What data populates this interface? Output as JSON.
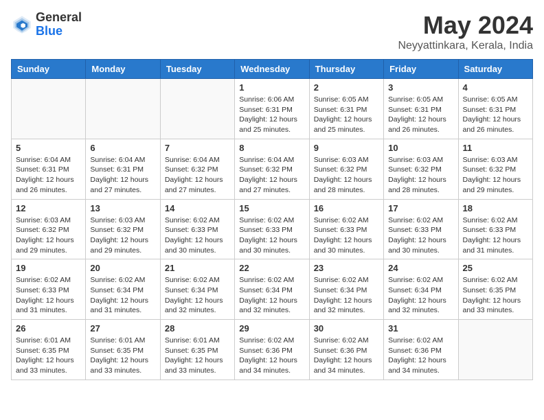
{
  "header": {
    "logo_general": "General",
    "logo_blue": "Blue",
    "title": "May 2024",
    "subtitle": "Neyyattinkara, Kerala, India"
  },
  "weekdays": [
    "Sunday",
    "Monday",
    "Tuesday",
    "Wednesday",
    "Thursday",
    "Friday",
    "Saturday"
  ],
  "weeks": [
    [
      {
        "day": "",
        "info": ""
      },
      {
        "day": "",
        "info": ""
      },
      {
        "day": "",
        "info": ""
      },
      {
        "day": "1",
        "info": "Sunrise: 6:06 AM\nSunset: 6:31 PM\nDaylight: 12 hours\nand 25 minutes."
      },
      {
        "day": "2",
        "info": "Sunrise: 6:05 AM\nSunset: 6:31 PM\nDaylight: 12 hours\nand 25 minutes."
      },
      {
        "day": "3",
        "info": "Sunrise: 6:05 AM\nSunset: 6:31 PM\nDaylight: 12 hours\nand 26 minutes."
      },
      {
        "day": "4",
        "info": "Sunrise: 6:05 AM\nSunset: 6:31 PM\nDaylight: 12 hours\nand 26 minutes."
      }
    ],
    [
      {
        "day": "5",
        "info": "Sunrise: 6:04 AM\nSunset: 6:31 PM\nDaylight: 12 hours\nand 26 minutes."
      },
      {
        "day": "6",
        "info": "Sunrise: 6:04 AM\nSunset: 6:31 PM\nDaylight: 12 hours\nand 27 minutes."
      },
      {
        "day": "7",
        "info": "Sunrise: 6:04 AM\nSunset: 6:32 PM\nDaylight: 12 hours\nand 27 minutes."
      },
      {
        "day": "8",
        "info": "Sunrise: 6:04 AM\nSunset: 6:32 PM\nDaylight: 12 hours\nand 27 minutes."
      },
      {
        "day": "9",
        "info": "Sunrise: 6:03 AM\nSunset: 6:32 PM\nDaylight: 12 hours\nand 28 minutes."
      },
      {
        "day": "10",
        "info": "Sunrise: 6:03 AM\nSunset: 6:32 PM\nDaylight: 12 hours\nand 28 minutes."
      },
      {
        "day": "11",
        "info": "Sunrise: 6:03 AM\nSunset: 6:32 PM\nDaylight: 12 hours\nand 29 minutes."
      }
    ],
    [
      {
        "day": "12",
        "info": "Sunrise: 6:03 AM\nSunset: 6:32 PM\nDaylight: 12 hours\nand 29 minutes."
      },
      {
        "day": "13",
        "info": "Sunrise: 6:03 AM\nSunset: 6:32 PM\nDaylight: 12 hours\nand 29 minutes."
      },
      {
        "day": "14",
        "info": "Sunrise: 6:02 AM\nSunset: 6:33 PM\nDaylight: 12 hours\nand 30 minutes."
      },
      {
        "day": "15",
        "info": "Sunrise: 6:02 AM\nSunset: 6:33 PM\nDaylight: 12 hours\nand 30 minutes."
      },
      {
        "day": "16",
        "info": "Sunrise: 6:02 AM\nSunset: 6:33 PM\nDaylight: 12 hours\nand 30 minutes."
      },
      {
        "day": "17",
        "info": "Sunrise: 6:02 AM\nSunset: 6:33 PM\nDaylight: 12 hours\nand 30 minutes."
      },
      {
        "day": "18",
        "info": "Sunrise: 6:02 AM\nSunset: 6:33 PM\nDaylight: 12 hours\nand 31 minutes."
      }
    ],
    [
      {
        "day": "19",
        "info": "Sunrise: 6:02 AM\nSunset: 6:33 PM\nDaylight: 12 hours\nand 31 minutes."
      },
      {
        "day": "20",
        "info": "Sunrise: 6:02 AM\nSunset: 6:34 PM\nDaylight: 12 hours\nand 31 minutes."
      },
      {
        "day": "21",
        "info": "Sunrise: 6:02 AM\nSunset: 6:34 PM\nDaylight: 12 hours\nand 32 minutes."
      },
      {
        "day": "22",
        "info": "Sunrise: 6:02 AM\nSunset: 6:34 PM\nDaylight: 12 hours\nand 32 minutes."
      },
      {
        "day": "23",
        "info": "Sunrise: 6:02 AM\nSunset: 6:34 PM\nDaylight: 12 hours\nand 32 minutes."
      },
      {
        "day": "24",
        "info": "Sunrise: 6:02 AM\nSunset: 6:34 PM\nDaylight: 12 hours\nand 32 minutes."
      },
      {
        "day": "25",
        "info": "Sunrise: 6:02 AM\nSunset: 6:35 PM\nDaylight: 12 hours\nand 33 minutes."
      }
    ],
    [
      {
        "day": "26",
        "info": "Sunrise: 6:01 AM\nSunset: 6:35 PM\nDaylight: 12 hours\nand 33 minutes."
      },
      {
        "day": "27",
        "info": "Sunrise: 6:01 AM\nSunset: 6:35 PM\nDaylight: 12 hours\nand 33 minutes."
      },
      {
        "day": "28",
        "info": "Sunrise: 6:01 AM\nSunset: 6:35 PM\nDaylight: 12 hours\nand 33 minutes."
      },
      {
        "day": "29",
        "info": "Sunrise: 6:02 AM\nSunset: 6:36 PM\nDaylight: 12 hours\nand 34 minutes."
      },
      {
        "day": "30",
        "info": "Sunrise: 6:02 AM\nSunset: 6:36 PM\nDaylight: 12 hours\nand 34 minutes."
      },
      {
        "day": "31",
        "info": "Sunrise: 6:02 AM\nSunset: 6:36 PM\nDaylight: 12 hours\nand 34 minutes."
      },
      {
        "day": "",
        "info": ""
      }
    ]
  ]
}
